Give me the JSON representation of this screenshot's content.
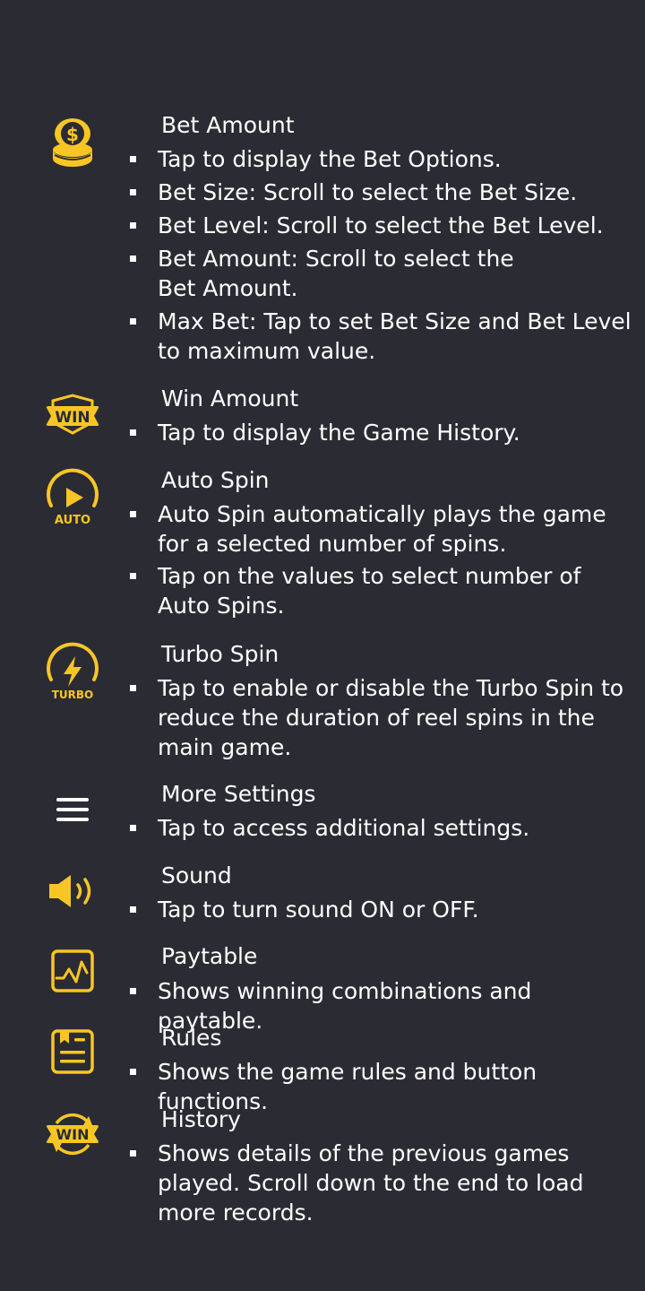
{
  "colors": {
    "background": "#2b2b33",
    "accent": "#f7c624",
    "text": "#ffffff"
  },
  "sections": [
    {
      "icon": "coins-icon",
      "title": "Bet Amount",
      "bullets": [
        "Tap to display the Bet Options.",
        "Bet Size: Scroll to select the Bet Size.",
        "Bet Level: Scroll to select the Bet Level.",
        "Bet Amount: Scroll to select the Bet Amount.",
        "Max Bet: Tap to set Bet Size and Bet Level to maximum value."
      ]
    },
    {
      "icon": "win-badge-icon",
      "title": "Win Amount",
      "icon_text": "WIN",
      "bullets": [
        "Tap to display the Game History."
      ]
    },
    {
      "icon": "auto-spin-icon",
      "title": "Auto Spin",
      "icon_text": "AUTO",
      "bullets": [
        "Auto Spin automatically plays the game for a selected number of spins.",
        "Tap on the values to select number of Auto Spins."
      ]
    },
    {
      "icon": "turbo-icon",
      "title": "Turbo Spin",
      "icon_text": "TURBO",
      "bullets": [
        "Tap to enable or disable the Turbo Spin to reduce the duration of reel spins in the main game."
      ]
    },
    {
      "icon": "menu-icon",
      "title": "More Settings",
      "bullets": [
        "Tap to access additional settings."
      ]
    },
    {
      "icon": "speaker-icon",
      "title": "Sound",
      "bullets": [
        "Tap to turn sound ON or OFF."
      ]
    },
    {
      "icon": "paytable-icon",
      "title": "Paytable",
      "bullets": [
        "Shows winning combinations and paytable."
      ]
    },
    {
      "icon": "rules-icon",
      "title": "Rules",
      "bullets": [
        "Shows the game rules and button functions."
      ]
    },
    {
      "icon": "history-icon",
      "title": "History",
      "icon_text": "WIN",
      "bullets": [
        "Shows details of the previous games played. Scroll down to the end to load more records."
      ]
    }
  ]
}
